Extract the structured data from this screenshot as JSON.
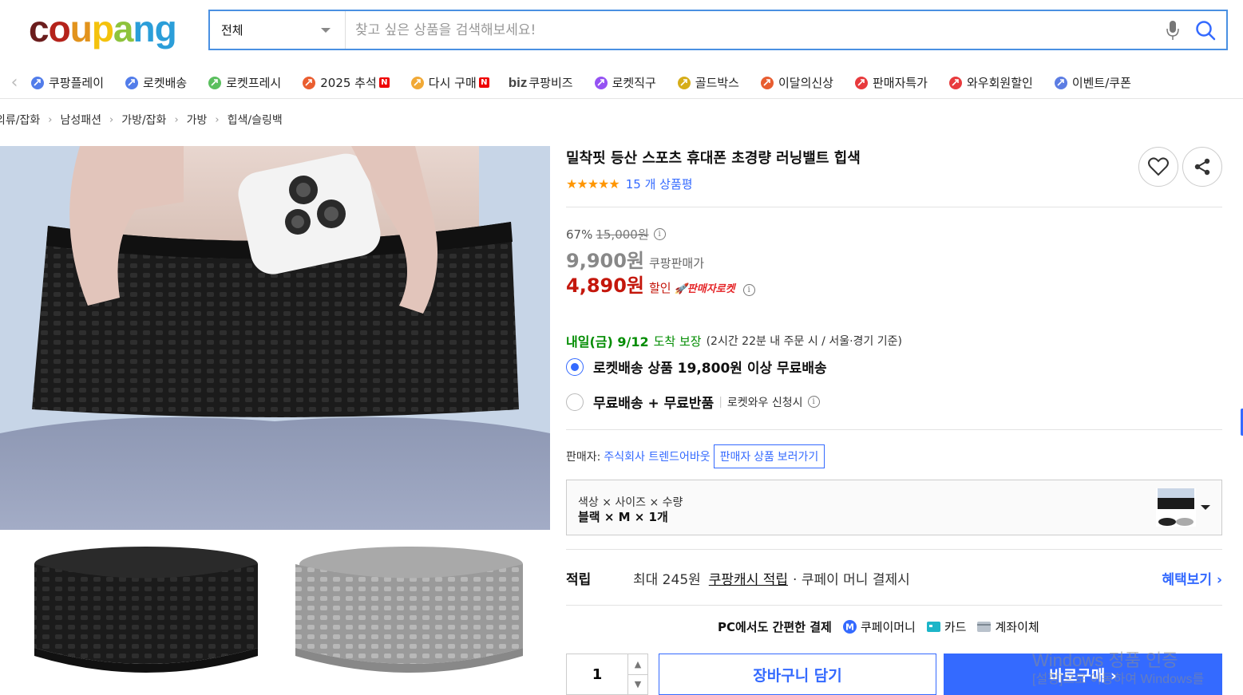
{
  "header": {
    "logo_text": [
      "c",
      "o",
      "u",
      "p",
      "a",
      "n",
      "g"
    ],
    "logo_colors": [
      "#6b1d1d",
      "#b5231b",
      "#e2931c",
      "#f4c20d",
      "#8ec33d",
      "#2b9ed9",
      "#2b9ed9"
    ],
    "search_category": "전체",
    "search_placeholder": "찾고 싶은 상품을 검색해보세요!",
    "accent_color": "#346aff"
  },
  "nav": {
    "items": [
      {
        "label": "쿠팡플레이",
        "icon": "coupang-play-icon",
        "badge": ""
      },
      {
        "label": "로켓배송",
        "icon": "rocket-icon",
        "badge": ""
      },
      {
        "label": "로켓프레시",
        "icon": "rocket-fresh-icon",
        "badge": ""
      },
      {
        "label": "2025 추석",
        "icon": "chuseok-icon",
        "badge": "N"
      },
      {
        "label": "다시 구매",
        "icon": "rebuy-icon",
        "badge": "N"
      },
      {
        "label": "쿠팡비즈",
        "icon": "biz-icon",
        "prefix": "biz",
        "badge": ""
      },
      {
        "label": "로켓직구",
        "icon": "rocket-global-icon",
        "badge": ""
      },
      {
        "label": "골드박스",
        "icon": "goldbox-icon",
        "badge": ""
      },
      {
        "label": "이달의신상",
        "icon": "new-icon",
        "badge": ""
      },
      {
        "label": "판매자특가",
        "icon": "seller-deal-icon",
        "badge": ""
      },
      {
        "label": "와우회원할인",
        "icon": "wow-icon",
        "badge": ""
      },
      {
        "label": "이벤트/쿠폰",
        "icon": "coupon-icon",
        "badge": ""
      }
    ]
  },
  "breadcrumb": [
    "의류/잡화",
    "남성패션",
    "가방/잡화",
    "가방",
    "힙색/슬링백"
  ],
  "product": {
    "title": "밀착핏 등산 스포츠 휴대폰 초경량 러닝밸트 힙색",
    "review_text": "15 개 상품평",
    "rating_stars": "★★★★★",
    "discount_rate": "67%",
    "original_price": "15,000원",
    "coupang_price": "9,900원",
    "coupang_price_label": "쿠팡판매가",
    "sale_price": "4,890원",
    "sale_label": "할인",
    "seller_rocket": "판매자로켓",
    "delivery_date": "내일(금) 9/12",
    "delivery_arrive": "도착 보장",
    "delivery_note": "(2시간 22분 내 주문 시 / 서울·경기 기준)",
    "ship_option_1": "로켓배송 상품 19,800원 이상 무료배송",
    "ship_option_2": "무료배송 + 무료반품",
    "ship_option_2_sub": "로켓와우 신청시",
    "seller_prefix": "판매자:",
    "seller_name": "주식회사 트렌드어바웃",
    "seller_button": "판매자 상품 보러가기",
    "option_header": "색상 × 사이즈 × 수량",
    "option_value": "블랙 × M × 1개",
    "reward_title": "적립",
    "reward_text_1": "최대 245원",
    "reward_link_cash": "쿠팡캐시 적립",
    "reward_text_2": "· 쿠페이 머니 결제시",
    "reward_more": "혜택보기",
    "pay_title": "PC에서도 간편한 결제",
    "pay_methods": [
      "쿠페이머니",
      "카드",
      "계좌이체"
    ],
    "quantity": "1",
    "cart_button": "장바구니 담기",
    "buy_button": "바로구매"
  },
  "watermark": {
    "line1": "Windows 정품 인증",
    "line2": "[설정]으로 이동하여 Windows를"
  }
}
